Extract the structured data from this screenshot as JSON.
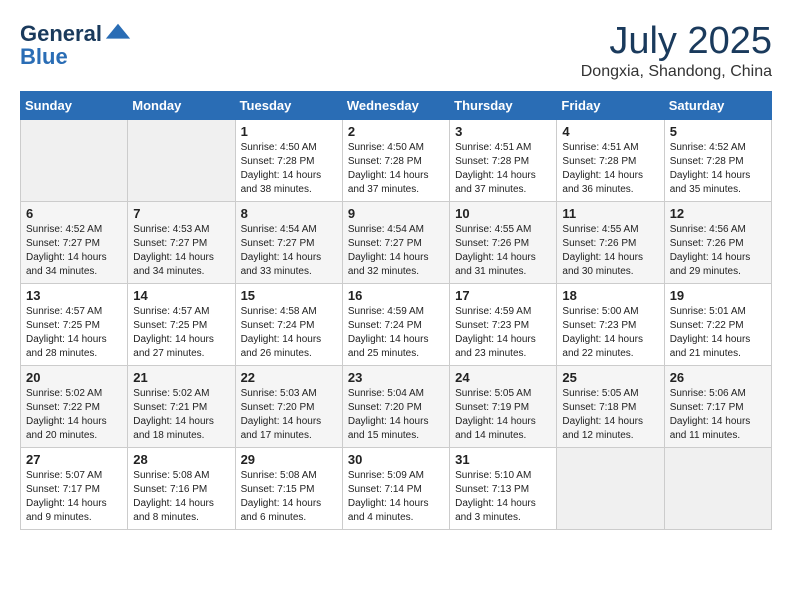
{
  "logo": {
    "general": "General",
    "blue": "Blue"
  },
  "title": "July 2025",
  "subtitle": "Dongxia, Shandong, China",
  "weekdays": [
    "Sunday",
    "Monday",
    "Tuesday",
    "Wednesday",
    "Thursday",
    "Friday",
    "Saturday"
  ],
  "weeks": [
    [
      {
        "day": "",
        "info": ""
      },
      {
        "day": "",
        "info": ""
      },
      {
        "day": "1",
        "info": "Sunrise: 4:50 AM\nSunset: 7:28 PM\nDaylight: 14 hours and 38 minutes."
      },
      {
        "day": "2",
        "info": "Sunrise: 4:50 AM\nSunset: 7:28 PM\nDaylight: 14 hours and 37 minutes."
      },
      {
        "day": "3",
        "info": "Sunrise: 4:51 AM\nSunset: 7:28 PM\nDaylight: 14 hours and 37 minutes."
      },
      {
        "day": "4",
        "info": "Sunrise: 4:51 AM\nSunset: 7:28 PM\nDaylight: 14 hours and 36 minutes."
      },
      {
        "day": "5",
        "info": "Sunrise: 4:52 AM\nSunset: 7:28 PM\nDaylight: 14 hours and 35 minutes."
      }
    ],
    [
      {
        "day": "6",
        "info": "Sunrise: 4:52 AM\nSunset: 7:27 PM\nDaylight: 14 hours and 34 minutes."
      },
      {
        "day": "7",
        "info": "Sunrise: 4:53 AM\nSunset: 7:27 PM\nDaylight: 14 hours and 34 minutes."
      },
      {
        "day": "8",
        "info": "Sunrise: 4:54 AM\nSunset: 7:27 PM\nDaylight: 14 hours and 33 minutes."
      },
      {
        "day": "9",
        "info": "Sunrise: 4:54 AM\nSunset: 7:27 PM\nDaylight: 14 hours and 32 minutes."
      },
      {
        "day": "10",
        "info": "Sunrise: 4:55 AM\nSunset: 7:26 PM\nDaylight: 14 hours and 31 minutes."
      },
      {
        "day": "11",
        "info": "Sunrise: 4:55 AM\nSunset: 7:26 PM\nDaylight: 14 hours and 30 minutes."
      },
      {
        "day": "12",
        "info": "Sunrise: 4:56 AM\nSunset: 7:26 PM\nDaylight: 14 hours and 29 minutes."
      }
    ],
    [
      {
        "day": "13",
        "info": "Sunrise: 4:57 AM\nSunset: 7:25 PM\nDaylight: 14 hours and 28 minutes."
      },
      {
        "day": "14",
        "info": "Sunrise: 4:57 AM\nSunset: 7:25 PM\nDaylight: 14 hours and 27 minutes."
      },
      {
        "day": "15",
        "info": "Sunrise: 4:58 AM\nSunset: 7:24 PM\nDaylight: 14 hours and 26 minutes."
      },
      {
        "day": "16",
        "info": "Sunrise: 4:59 AM\nSunset: 7:24 PM\nDaylight: 14 hours and 25 minutes."
      },
      {
        "day": "17",
        "info": "Sunrise: 4:59 AM\nSunset: 7:23 PM\nDaylight: 14 hours and 23 minutes."
      },
      {
        "day": "18",
        "info": "Sunrise: 5:00 AM\nSunset: 7:23 PM\nDaylight: 14 hours and 22 minutes."
      },
      {
        "day": "19",
        "info": "Sunrise: 5:01 AM\nSunset: 7:22 PM\nDaylight: 14 hours and 21 minutes."
      }
    ],
    [
      {
        "day": "20",
        "info": "Sunrise: 5:02 AM\nSunset: 7:22 PM\nDaylight: 14 hours and 20 minutes."
      },
      {
        "day": "21",
        "info": "Sunrise: 5:02 AM\nSunset: 7:21 PM\nDaylight: 14 hours and 18 minutes."
      },
      {
        "day": "22",
        "info": "Sunrise: 5:03 AM\nSunset: 7:20 PM\nDaylight: 14 hours and 17 minutes."
      },
      {
        "day": "23",
        "info": "Sunrise: 5:04 AM\nSunset: 7:20 PM\nDaylight: 14 hours and 15 minutes."
      },
      {
        "day": "24",
        "info": "Sunrise: 5:05 AM\nSunset: 7:19 PM\nDaylight: 14 hours and 14 minutes."
      },
      {
        "day": "25",
        "info": "Sunrise: 5:05 AM\nSunset: 7:18 PM\nDaylight: 14 hours and 12 minutes."
      },
      {
        "day": "26",
        "info": "Sunrise: 5:06 AM\nSunset: 7:17 PM\nDaylight: 14 hours and 11 minutes."
      }
    ],
    [
      {
        "day": "27",
        "info": "Sunrise: 5:07 AM\nSunset: 7:17 PM\nDaylight: 14 hours and 9 minutes."
      },
      {
        "day": "28",
        "info": "Sunrise: 5:08 AM\nSunset: 7:16 PM\nDaylight: 14 hours and 8 minutes."
      },
      {
        "day": "29",
        "info": "Sunrise: 5:08 AM\nSunset: 7:15 PM\nDaylight: 14 hours and 6 minutes."
      },
      {
        "day": "30",
        "info": "Sunrise: 5:09 AM\nSunset: 7:14 PM\nDaylight: 14 hours and 4 minutes."
      },
      {
        "day": "31",
        "info": "Sunrise: 5:10 AM\nSunset: 7:13 PM\nDaylight: 14 hours and 3 minutes."
      },
      {
        "day": "",
        "info": ""
      },
      {
        "day": "",
        "info": ""
      }
    ]
  ]
}
